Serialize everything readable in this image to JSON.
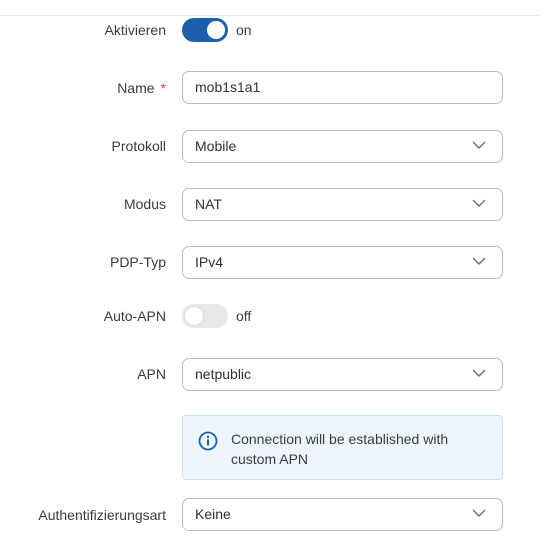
{
  "form": {
    "enable": {
      "label": "Aktivieren",
      "state": "on"
    },
    "name": {
      "label": "Name",
      "required_mark": "*",
      "value": "mob1s1a1"
    },
    "protocol": {
      "label": "Protokoll",
      "value": "Mobile"
    },
    "mode": {
      "label": "Modus",
      "value": "NAT"
    },
    "pdp_type": {
      "label": "PDP-Typ",
      "value": "IPv4"
    },
    "auto_apn": {
      "label": "Auto-APN",
      "state": "off"
    },
    "apn": {
      "label": "APN",
      "value": "netpublic"
    },
    "notice": {
      "icon": "info-icon",
      "text": "Connection will be established with custom APN"
    },
    "auth": {
      "label": "Authentifizierungsart",
      "value": "Keine"
    }
  },
  "colors": {
    "toggle_on": "#1e5fad",
    "toggle_off": "#e8e8ea",
    "required": "#e04a3b",
    "info_bg": "#eef6fb",
    "info_icon": "#1e5fad"
  }
}
